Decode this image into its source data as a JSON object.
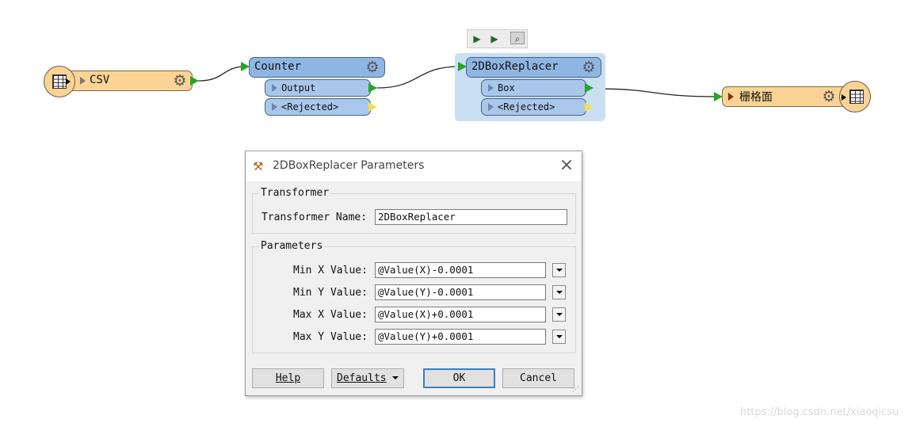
{
  "canvas": {
    "reader": {
      "label": "CSV",
      "icon": "table-icon"
    },
    "counter": {
      "label": "Counter",
      "ports": [
        "Output",
        "<Rejected>"
      ]
    },
    "boxreplacer": {
      "label": "2DBoxReplacer",
      "ports": [
        "Box",
        "<Rejected>"
      ]
    },
    "writer": {
      "label": "栅格面",
      "icon": "table-icon"
    },
    "mini_toolbar": [
      "run-to-here-icon",
      "run-from-here-icon",
      "inspect-icon"
    ]
  },
  "dialog": {
    "title": "2DBoxReplacer Parameters",
    "transformer_group": "Transformer",
    "transformer_name_label": "Transformer Name:",
    "transformer_name_value": "2DBoxReplacer",
    "parameters_group": "Parameters",
    "params": [
      {
        "label": "Min X Value:",
        "value": "@Value(X)-0.0001"
      },
      {
        "label": "Min Y Value:",
        "value": "@Value(Y)-0.0001"
      },
      {
        "label": "Max X Value:",
        "value": "@Value(X)+0.0001"
      },
      {
        "label": "Max Y Value:",
        "value": "@Value(Y)+0.0001"
      }
    ],
    "buttons": {
      "help": "Help",
      "defaults": "Defaults",
      "ok": "OK",
      "cancel": "Cancel"
    }
  },
  "watermark": "https://blog.csdn.net/xiaoqicsu",
  "colors": {
    "feature_node": "#fbd394",
    "transformer_head": "#8fb6e3",
    "transformer_port": "#a9c7ea",
    "selection": "#cadff4",
    "output_port": "#25a52a",
    "rejected_port": "#f0e05a"
  }
}
